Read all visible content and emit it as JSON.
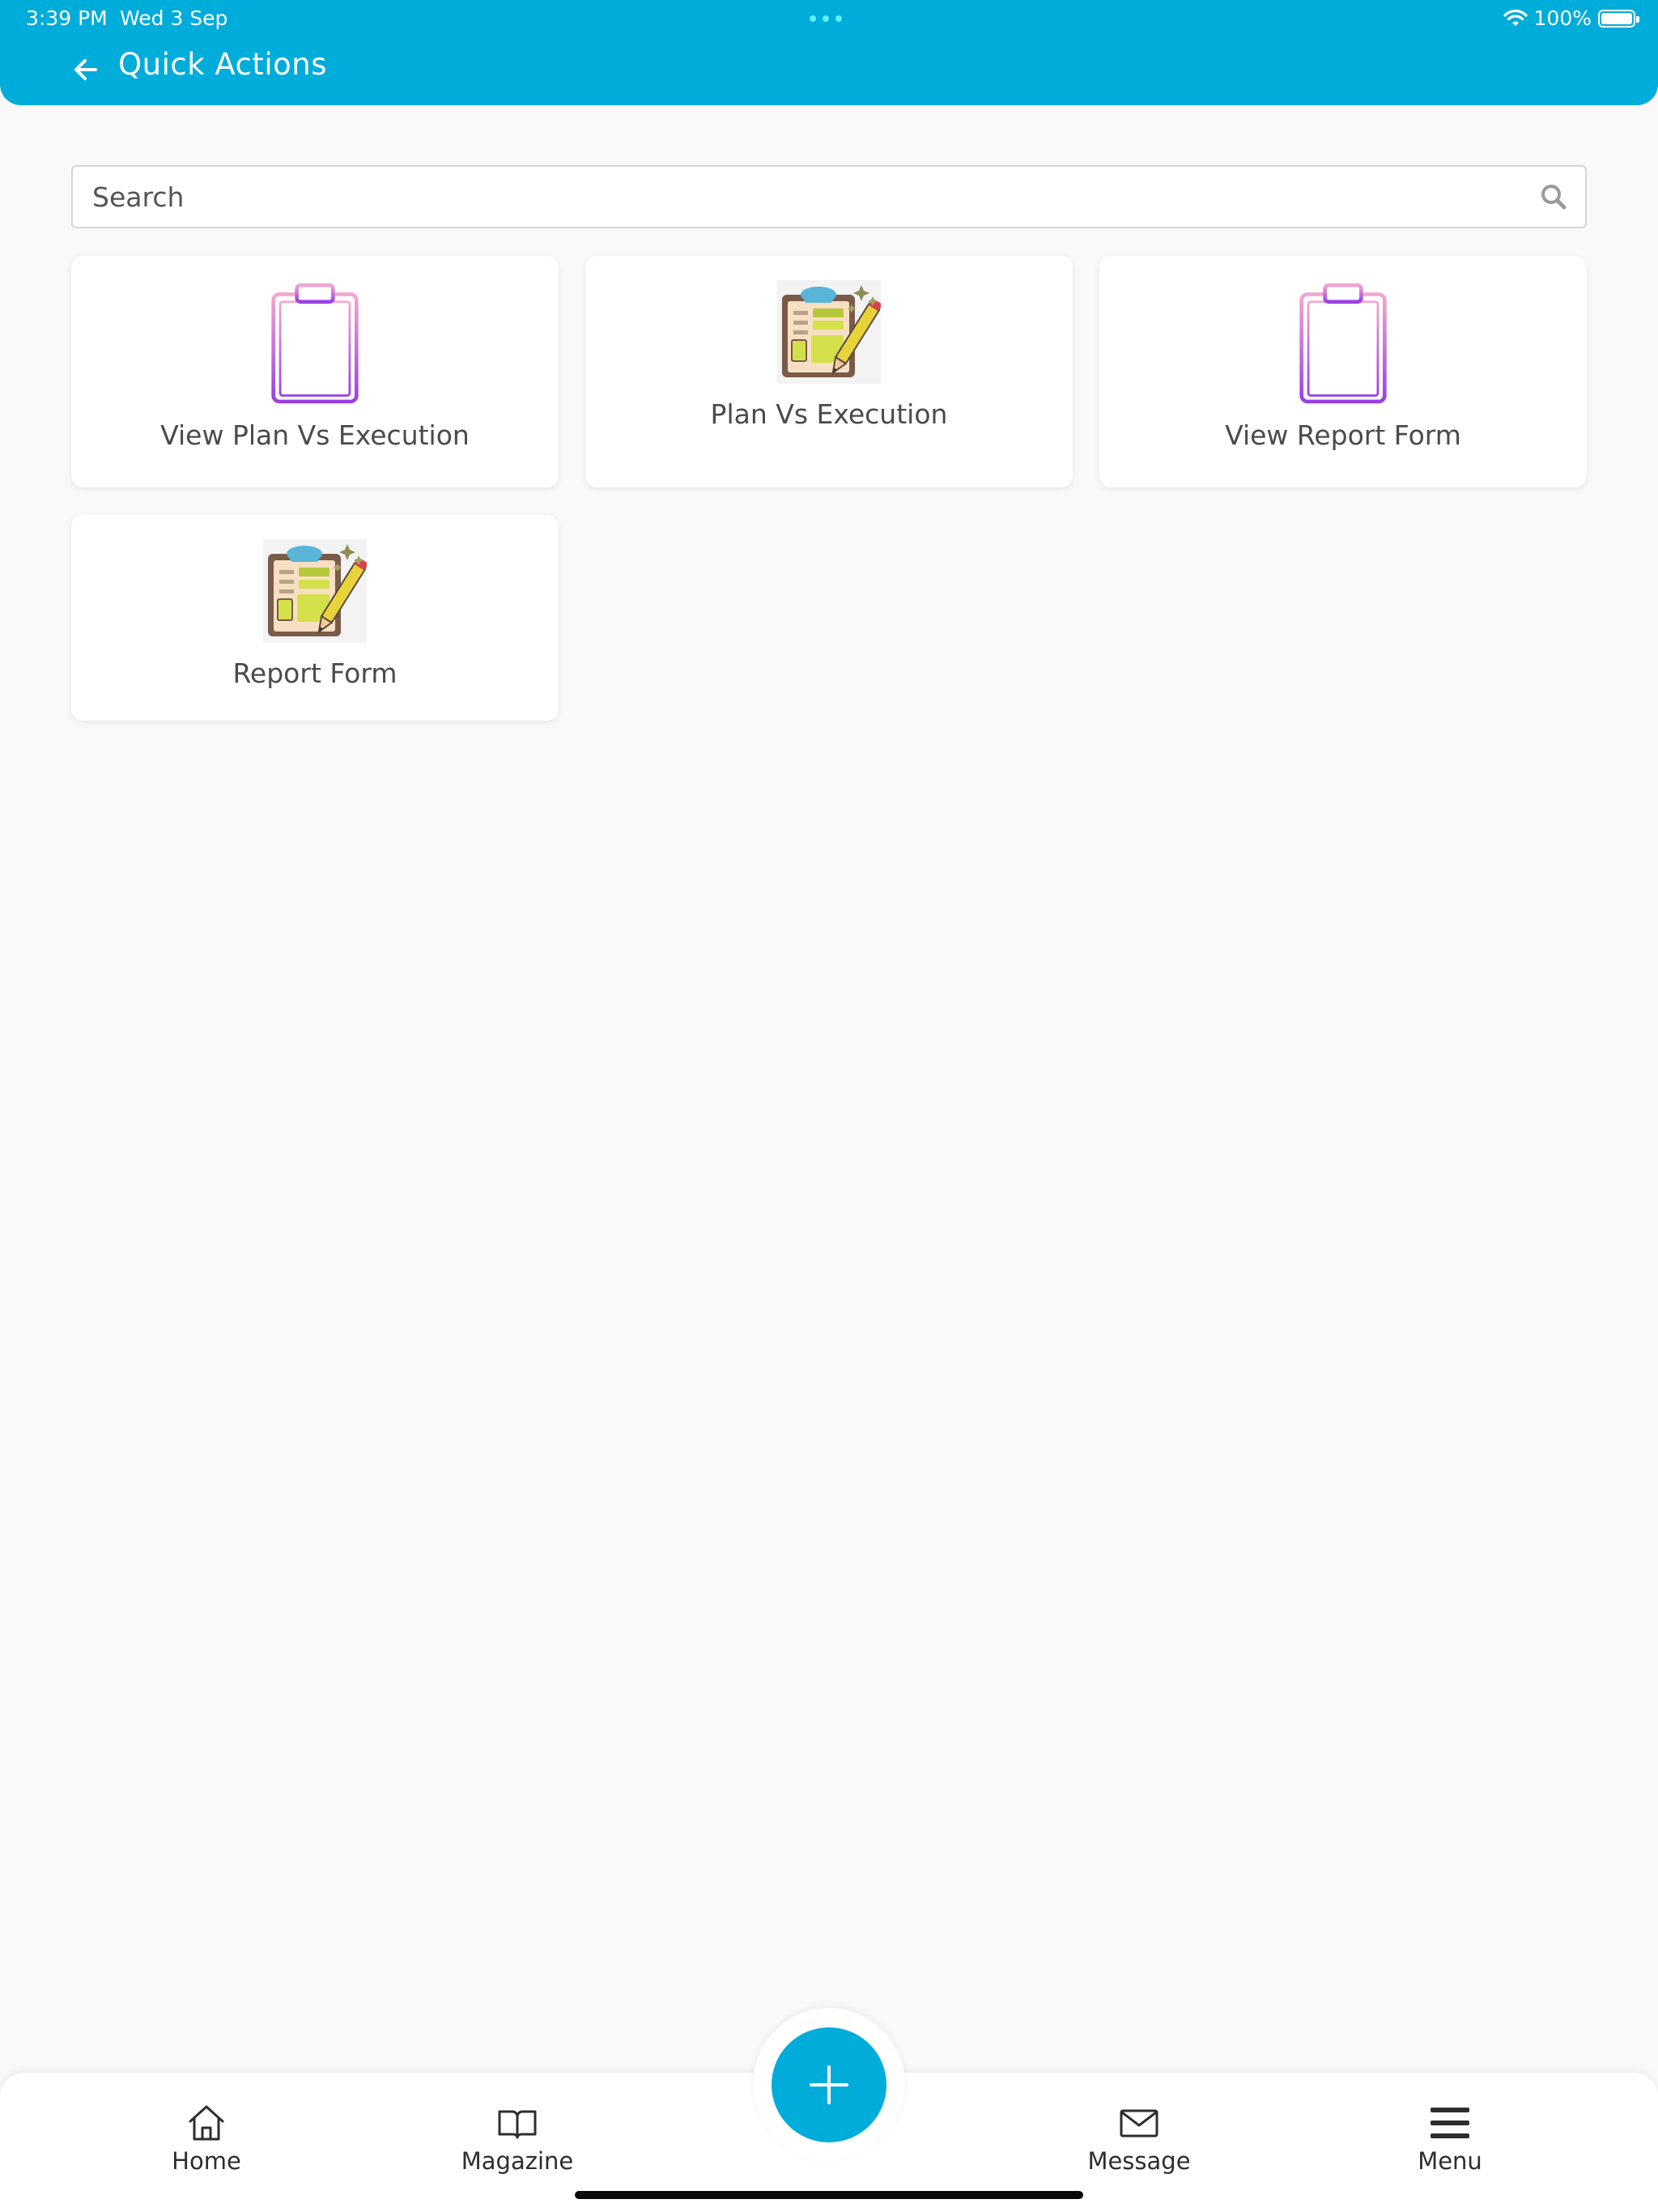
{
  "status_bar": {
    "time": "3:39 PM",
    "date": "Wed 3 Sep",
    "battery": "100%",
    "battery_level": 1.0
  },
  "header": {
    "title": "Quick Actions",
    "back_icon": "arrow-left-icon",
    "background_color": "#00acd9"
  },
  "search": {
    "placeholder": "Search",
    "value": "",
    "icon": "search-icon"
  },
  "actions": [
    {
      "label": "View Plan Vs Execution",
      "icon": "medical-clipboard-icon"
    },
    {
      "label": "Plan Vs Execution",
      "icon": "clipboard-pencil-icon"
    },
    {
      "label": "View Report Form",
      "icon": "medical-clipboard-icon"
    },
    {
      "label": "Report Form",
      "icon": "clipboard-pencil-icon"
    }
  ],
  "bottom_nav": {
    "items": [
      {
        "label": "Home",
        "icon": "home-icon"
      },
      {
        "label": "Magazine",
        "icon": "book-icon"
      },
      {
        "label": "Message",
        "icon": "envelope-icon"
      },
      {
        "label": "Menu",
        "icon": "hamburger-menu-icon"
      }
    ],
    "fab_icon": "plus-icon",
    "accent_color": "#00acd9"
  }
}
